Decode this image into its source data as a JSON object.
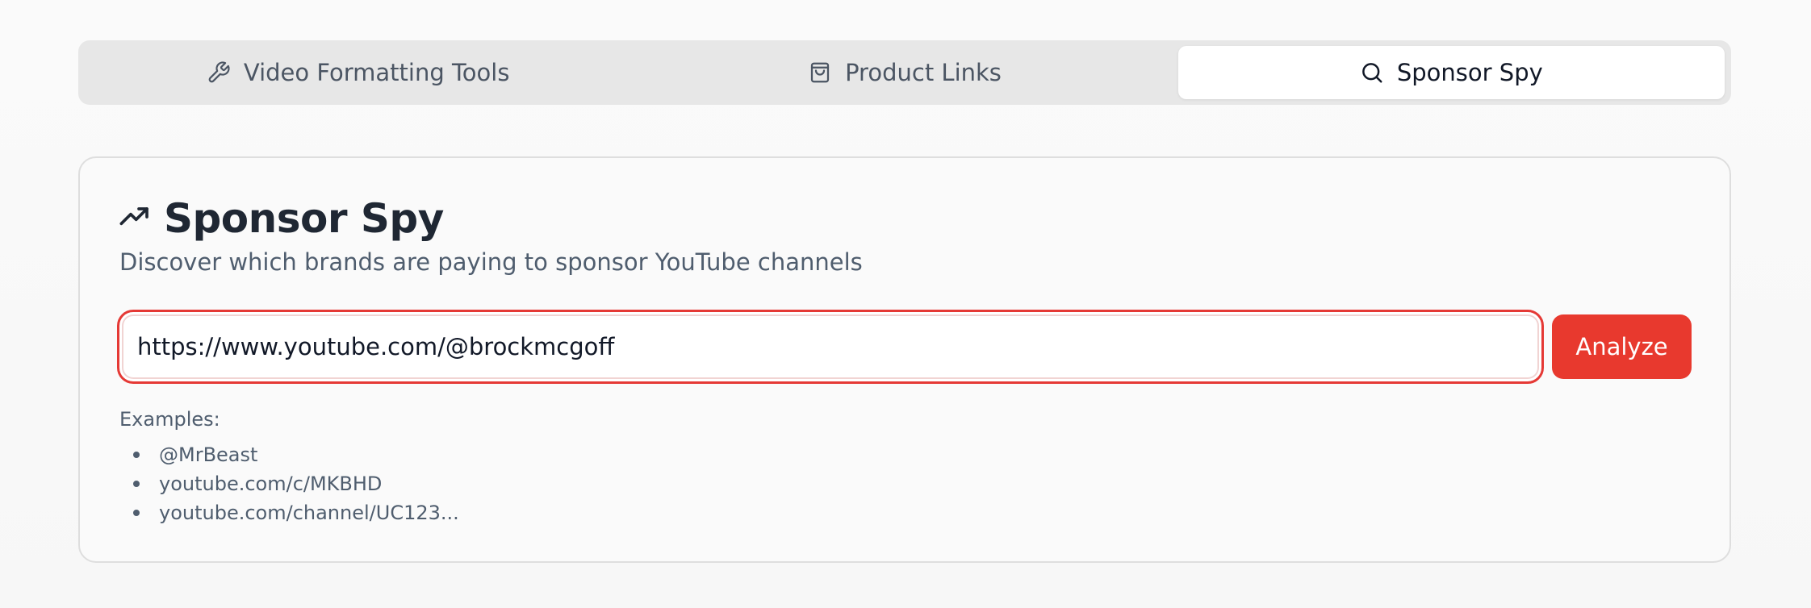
{
  "tabs": [
    {
      "label": "Video Formatting Tools",
      "icon": "wrench-icon",
      "active": false
    },
    {
      "label": "Product Links",
      "icon": "shopping-bag-icon",
      "active": false
    },
    {
      "label": "Sponsor Spy",
      "icon": "search-icon",
      "active": true
    }
  ],
  "card": {
    "title": "Sponsor Spy",
    "title_icon": "trending-up-icon",
    "subtitle": "Discover which brands are paying to sponsor YouTube channels"
  },
  "search": {
    "value": "https://www.youtube.com/@brockmcgoff",
    "button_label": "Analyze"
  },
  "examples": {
    "label": "Examples:",
    "items": [
      "@MrBeast",
      "youtube.com/c/MKBHD",
      "youtube.com/channel/UC123..."
    ]
  },
  "colors": {
    "accent": "#e8392e",
    "tab_bar": "#e7e7e7",
    "muted_text": "#4f5d6e"
  }
}
